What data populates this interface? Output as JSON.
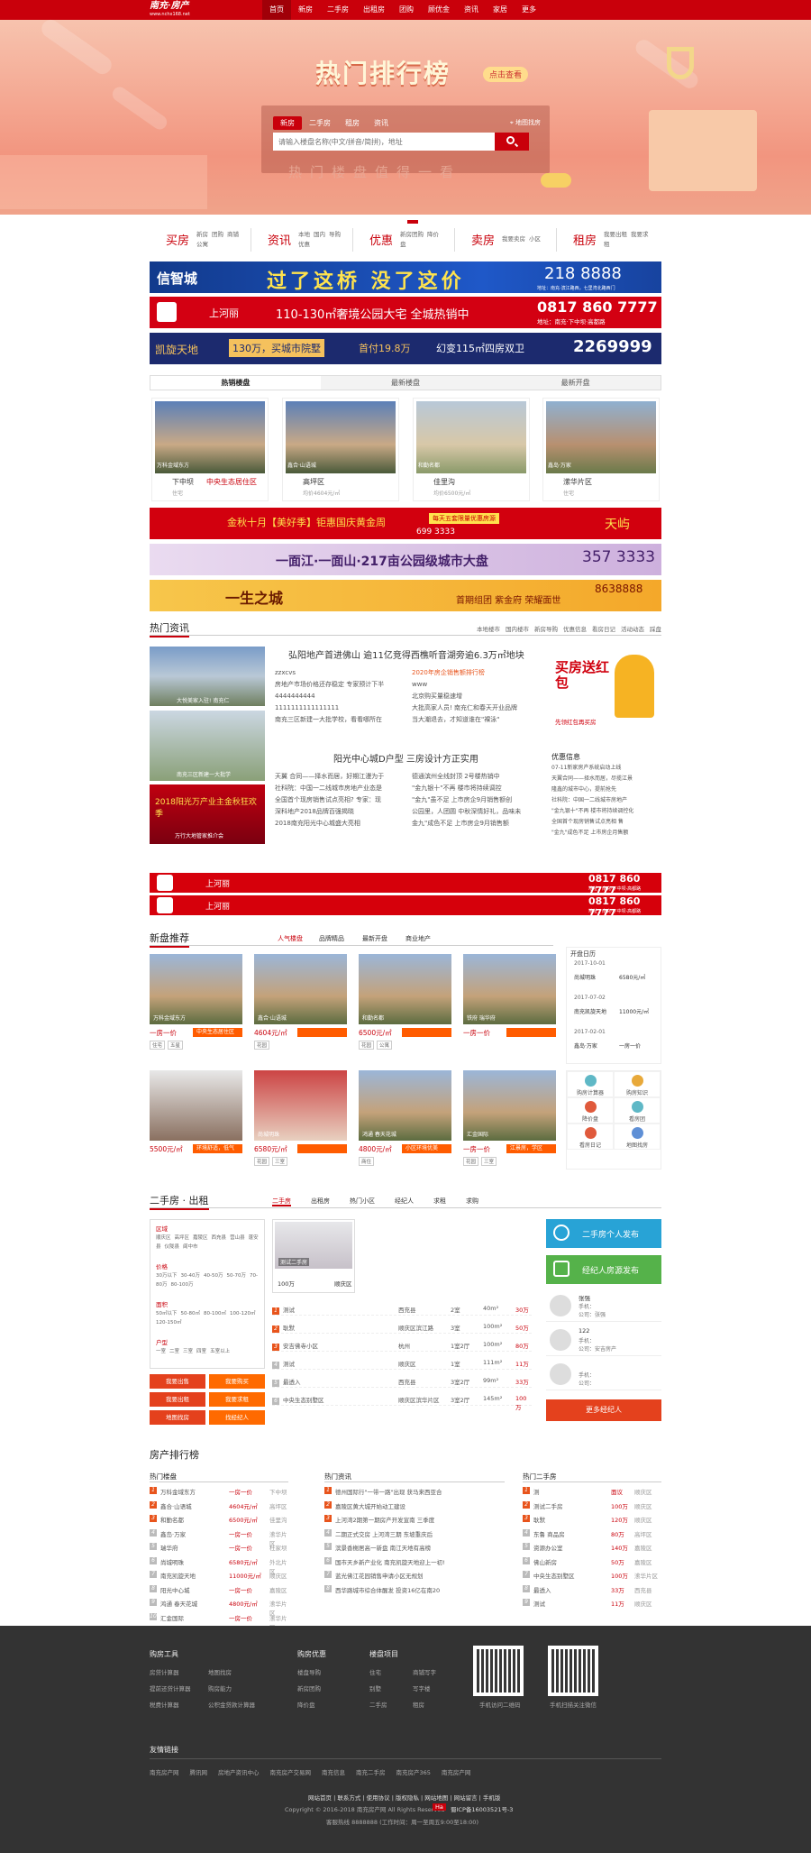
{
  "site": {
    "logo_text": "南充·房产",
    "logo_sub": "www.nchx168.net"
  },
  "nav": {
    "items": [
      "首页",
      "新房",
      "二手房",
      "出租房",
      "团购",
      "顾优金",
      "资讯",
      "家居",
      "更多"
    ]
  },
  "banner": {
    "title": "热门排行榜",
    "button": "点击查看",
    "slogan": "热门楼盘值得一看",
    "search_tabs": [
      "新房",
      "二手房",
      "租房",
      "资讯"
    ],
    "map_label": "地图找房",
    "placeholder": "请输入楼盘名称(中文/拼音/简拼)，地址"
  },
  "categories": [
    {
      "name": "买房",
      "links": [
        "新房",
        "团购",
        "商铺",
        "公寓"
      ]
    },
    {
      "name": "资讯",
      "links": [
        "本地",
        "国内",
        "导购",
        "优惠"
      ]
    },
    {
      "name": "优惠",
      "links": [
        "新房团购",
        "降价盘"
      ]
    },
    {
      "name": "卖房",
      "links": [
        "我要卖房",
        "小区"
      ]
    },
    {
      "name": "租房",
      "links": [
        "我要出租",
        "我要求租"
      ]
    }
  ],
  "ads": {
    "a1": {
      "brand": "信智城",
      "slogan": "过了这桥 没了这价",
      "phone": "218 8888",
      "addr": "地址：南充·滨江路西，七里湾北路西门"
    },
    "a2": {
      "brand": "上河丽",
      "area": "110-130㎡奢境公园大宅 全城热销中",
      "phone": "0817 860 7777",
      "addr": "地址：南充·下中坝·高都路"
    },
    "a3": {
      "brand": "凯旋天地",
      "t1": "130万，买城市院墅",
      "t2": "首付19.8万",
      "t3": "幻变115㎡四房双卫",
      "phone": "2269999"
    },
    "a4": {
      "t": "金秋十月【美好季】钜惠国庆黄金周",
      "sub": "每天五套限量优惠房源",
      "phone": "699 3333",
      "brand": "天屿"
    },
    "a5": {
      "t": "一面江·一面山·217亩公园级城市大盘",
      "phone": "357 3333"
    },
    "a6": {
      "brand": "一生之城",
      "t": "首期组团 紫金府 荣耀面世",
      "phone": "8638888"
    },
    "a7": {
      "brand": "上河丽",
      "phone": "0817 860 7777",
      "addr": "地址：南充·下中坝·高都路"
    }
  },
  "listing_tabs": [
    "热销楼盘",
    "最新楼盘",
    "最新开盘"
  ],
  "hot_props": [
    {
      "cap": "万科金域东方",
      "name": "下中坝",
      "sub": "住宅",
      "red": "中央生态居住区"
    },
    {
      "cap": "鑫合·山语城",
      "name": "高坪区",
      "sub": "均价4604元/㎡"
    },
    {
      "cap": "和勤名都",
      "name": "佳里沟",
      "sub": "均价6500元/㎡"
    },
    {
      "cap": "鑫岛·万家",
      "name": "潆华片区",
      "sub": "住宅"
    }
  ],
  "news": {
    "title": "热门资讯",
    "links": [
      "本地楼市",
      "国内楼市",
      "新房导购",
      "优惠信息",
      "看房日记",
      "活动动态",
      "踩盘"
    ],
    "headline1": "弘阳地产首进佛山 逾11亿竞得西樵听音湖旁逾6.3万㎡地块",
    "headline2": "阳光中心城D户型 三房设计方正实用",
    "col1": [
      "zzxcvs",
      "房地产市场价格还存稳定 专家预计下半",
      "4444444444",
      "1111111111111111",
      "南充三区新建一大批学校，看看哪所在"
    ],
    "col2": [
      "2020年房企销售额排行榜",
      "www",
      "北京购买量稳速增",
      "大批高家人员! 南充仁和春天开业品牌",
      "当大潮退去，才知道谁在\"裸泳\""
    ],
    "col3": [
      "天翼 合同——择水而居，好期江漫为于",
      "社科院：中国一二线城市房地产业态是",
      "全国首个现房销售试点亮相? 专家：现",
      "深科地产2018品牌百强揭晓",
      "2018南充阳光中心城盛大亮相"
    ],
    "col4": [
      "德通滨州全线封顶 2号楼热销中",
      "\"金九银十\"不再 楼市将持续调控",
      "\"金九\"虽不足 上市房企9月销售额创",
      "公园里，人团圆 中秋深情好礼，品味未",
      "金九\"成色不足 上市房企9月销售额"
    ],
    "promo": "买房送红包",
    "promo_sub": "先领红包再买房",
    "info_title": "优惠信息",
    "info": [
      "07-11新家房产系统启动上线",
      "天翼合同——择水而居，尽揽江景",
      "隆鑫的城市中心，提前抢先",
      "社科院：中国一二线城市房地产",
      "\"金九银十\"不再 楼市将持续调控化",
      "全国首个现房销售试点亮相 售",
      "\"金九\"成色不足 上市房企月售额"
    ],
    "tiles": [
      "大悦美家入驻! 南充仁",
      "南充三区新建一大批学",
      "2018阳光万产业主金秋狂欢季",
      "万行大地管家推介会"
    ]
  },
  "newprops": {
    "title": "新盘推荐",
    "tabs": [
      "人气楼盘",
      "品牌精品",
      "最新开盘",
      "商业地产"
    ],
    "items": [
      {
        "cap": "万科金域东方",
        "price": "一房一价",
        "tag": "中央生态居住区",
        "mini": [
          "住宅",
          "五星"
        ]
      },
      {
        "cap": "鑫合·山语城",
        "price": "4604元/㎡",
        "tag": "",
        "mini": [
          "花园"
        ]
      },
      {
        "cap": "和勤名都",
        "price": "6500元/㎡",
        "tag": "",
        "mini": [
          "花园",
          "公寓"
        ]
      },
      {
        "cap": "铁府 瑞华府",
        "price": "一房一价",
        "tag": "",
        "mini": []
      },
      {
        "cap": "",
        "price": "5500元/㎡",
        "tag": "环境舒适，低气",
        "mini": []
      },
      {
        "cap": "尚城明珠",
        "price": "6580元/㎡",
        "tag": "",
        "mini": [
          "花园",
          "三室"
        ]
      },
      {
        "cap": "鸿通 春天花城",
        "price": "4800元/㎡",
        "tag": "小区环境优美",
        "mini": [
          "商住"
        ]
      },
      {
        "cap": "汇金国际",
        "price": "一房一价",
        "tag": "江景房，学区",
        "mini": [
          "花园",
          "三室"
        ]
      }
    ],
    "calendar_title": "开盘日历",
    "calendar": [
      {
        "d": "2017-10-01",
        "n": "尚城明珠",
        "p": "6580元/㎡"
      },
      {
        "d": "2017-07-02",
        "n": "南充凯旋天地",
        "p": "11000元/㎡"
      },
      {
        "d": "2017-02-01",
        "n": "鑫岛·万家",
        "p": "一房一价"
      }
    ],
    "tools": [
      "购房计算器",
      "购房知识",
      "降价盘",
      "看房团",
      "看房日记",
      "地图找房"
    ]
  },
  "second": {
    "title": "二手房 · 出租",
    "tabs": [
      "二手房",
      "出租房",
      "热门小区",
      "经纪人",
      "求租",
      "求购"
    ],
    "filters": [
      {
        "k": "区域",
        "v": [
          "顺庆区",
          "高坪区",
          "嘉陵区",
          "西充县",
          "营山县",
          "蓬安县",
          "仪陇县",
          "阆中市"
        ]
      },
      {
        "k": "价格",
        "v": [
          "30万以下",
          "30-40万",
          "40-50万",
          "50-70万",
          "70-80万",
          "80-100万"
        ]
      },
      {
        "k": "面积",
        "v": [
          "50㎡以下",
          "50-80㎡",
          "80-100㎡",
          "100-120㎡",
          "120-150㎡"
        ]
      },
      {
        "k": "户型",
        "v": [
          "一室",
          "二室",
          "三室",
          "四室",
          "五室以上"
        ]
      }
    ],
    "btns": [
      "我要出售",
      "我要购买",
      "我要出租",
      "我要求租",
      "地图找房",
      "找经纪人"
    ],
    "feature": {
      "img": "测试二手房",
      "price": "100万",
      "area": "顺庆区"
    },
    "rows": [
      {
        "n": "测试",
        "a": "西充县",
        "r": "2室",
        "s": "40m²",
        "p": "30万"
      },
      {
        "n": "耿默",
        "a": "顺庆区滨江路",
        "r": "3室",
        "s": "100m²",
        "p": "50万"
      },
      {
        "n": "安吉佛寺小区",
        "a": "杭州",
        "r": "1室2厅",
        "s": "100m²",
        "p": "80万"
      },
      {
        "n": "测试",
        "a": "顺庆区",
        "r": "1室",
        "s": "111m²",
        "p": "11万"
      },
      {
        "n": "最透入",
        "a": "西充县",
        "r": "3室2厅",
        "s": "99m²",
        "p": "33万"
      },
      {
        "n": "中央生态别墅区",
        "a": "顺庆区滨华片区",
        "r": "3室2厅",
        "s": "145m²",
        "p": "100万"
      }
    ],
    "side_btns": [
      "二手房个人发布",
      "经纪人房源发布"
    ],
    "agents": [
      {
        "n": "张强",
        "p": "手机：",
        "c": "公司：张强"
      },
      {
        "n": "122",
        "p": "手机：",
        "c": "公司：安吉房产"
      },
      {
        "n": "",
        "p": "手机：",
        "c": "公司："
      }
    ],
    "more_agents": "更多经纪人"
  },
  "rank": {
    "title": "房产排行榜",
    "cols": [
      {
        "h": "热门楼盘",
        "items": [
          [
            "万科金域东方",
            "一房一价",
            "下中坝"
          ],
          [
            "鑫合·山语城",
            "4604元/㎡",
            "高坪区"
          ],
          [
            "和勤名都",
            "6500元/㎡",
            "佳里沟"
          ],
          [
            "鑫岛·万家",
            "一房一价",
            "潆华片区"
          ],
          [
            "瑞华府",
            "一房一价",
            "杜家坝"
          ],
          [
            "尚城明珠",
            "6580元/㎡",
            "外北片区"
          ],
          [
            "南充凯旋天地",
            "11000元/㎡",
            "顺庆区"
          ],
          [
            "阳光中心城",
            "一房一价",
            "嘉陵区"
          ],
          [
            "鸿通 春天花城",
            "4800元/㎡",
            "潆华片区"
          ],
          [
            "汇金国际",
            "一房一价",
            "潆华片区"
          ]
        ]
      },
      {
        "h": "热门资讯",
        "items": [
          [
            "德州国际行\"一带一路\"出现 获马来西亚合",
            "",
            ""
          ],
          [
            "嘉陵区黄大城开始动工建设",
            "",
            ""
          ],
          [
            "上河湾2期第一期房产开发宣南 三季度",
            "",
            ""
          ],
          [
            "二期正式交房 上河湾三期 东坡重庆后",
            "",
            ""
          ],
          [
            "滨景香榭居高一新盘 南江天地有高榜",
            "",
            ""
          ],
          [
            "国市天乡新产业化 南充凯旋天地迎上一初!",
            "",
            ""
          ],
          [
            "蓝光佛江花园销售申请小区无规划",
            "",
            ""
          ],
          [
            "西华路城市综合体醒发 投资16亿在南20",
            "",
            ""
          ]
        ]
      },
      {
        "h": "热门二手房",
        "items": [
          [
            "测",
            "面议",
            "顺庆区"
          ],
          [
            "测试二手房",
            "100万",
            "顺庆区"
          ],
          [
            "耿默",
            "120万",
            "顺庆区"
          ],
          [
            "东鲁 商品房",
            "80万",
            "高坪区"
          ],
          [
            "资源办公室",
            "140万",
            "嘉陵区"
          ],
          [
            "佛山新房",
            "50万",
            "嘉陵区"
          ],
          [
            "中央生态别墅区",
            "100万",
            "潆华片区"
          ],
          [
            "最透入",
            "33万",
            "西充县"
          ],
          [
            "测试",
            "11万",
            "顺庆区"
          ]
        ]
      }
    ]
  },
  "footer": {
    "cols": [
      {
        "h": "购房工具",
        "items": [
          "房贷计算器",
          "地图找房",
          "提前还贷计算器",
          "购房能力",
          "税费计算器",
          "公积金贷款计算器"
        ]
      },
      {
        "h": "购房优惠",
        "items": [
          "楼盘导购",
          "新房团购",
          "降价盘"
        ]
      },
      {
        "h": "楼盘项目",
        "items": [
          "住宅",
          "商铺写字",
          "别墅",
          "写字楼",
          "二手房",
          "租房"
        ]
      }
    ],
    "qr": [
      "手机访问二维码",
      "手机扫描关注微信"
    ],
    "links_title": "友情链接",
    "links": [
      "南充房产网",
      "腾讯网",
      "房地产资讯中心",
      "南充房产交易网",
      "南充信息",
      "南充二手房",
      "南充房产365",
      "南充房产网"
    ],
    "bottom_links": "网站首页 | 联系方式 | 使用协议 | 版权隐私 | 网站地图 | 网站留言 | 手机版",
    "copyright": "Copyright © 2016-2018 南充房产网 All Rights Reserved",
    "icp": "蜀ICP备16003521号-3",
    "phone": "客服热线 8888888 (工作时间：周一至周五9:00至18:00)"
  }
}
